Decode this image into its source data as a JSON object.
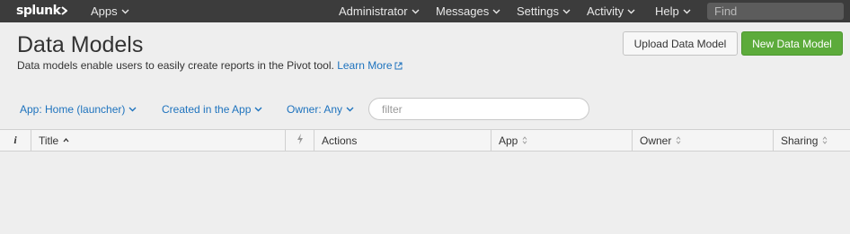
{
  "topbar": {
    "logo": "splunk",
    "apps_label": "Apps",
    "menu": {
      "administrator": "Administrator",
      "messages": "Messages",
      "settings": "Settings",
      "activity": "Activity",
      "help": "Help"
    },
    "find_placeholder": "Find"
  },
  "header": {
    "title": "Data Models",
    "description": "Data models enable users to easily create reports in the Pivot tool.",
    "learn_more": "Learn More",
    "upload_button": "Upload Data Model",
    "new_button": "New Data Model"
  },
  "filters": {
    "app": "App: Home (launcher)",
    "created": "Created in the App",
    "owner": "Owner: Any",
    "placeholder": "filter"
  },
  "table": {
    "columns": {
      "info": "i",
      "title": "Title",
      "actions": "Actions",
      "app": "App",
      "owner": "Owner",
      "sharing": "Sharing"
    },
    "rows": []
  },
  "colors": {
    "topbar_bg": "#3c3c3c",
    "page_bg": "#eeeeee",
    "link": "#1e73be",
    "primary_button": "#5cab3b"
  }
}
